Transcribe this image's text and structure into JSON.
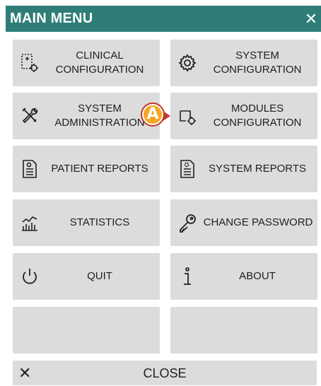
{
  "header": {
    "title": "MAIN MENU",
    "close_glyph": "✕"
  },
  "tiles": [
    {
      "line1": "CLINICAL",
      "line2": "CONFIGURATION",
      "icon": "clinical-config-icon"
    },
    {
      "line1": "SYSTEM",
      "line2": "CONFIGURATION",
      "icon": "gear-icon"
    },
    {
      "line1": "SYSTEM",
      "line2": "ADMINISTRATION",
      "icon": "tools-icon"
    },
    {
      "line1": "MODULES",
      "line2": "CONFIGURATION",
      "icon": "modules-config-icon"
    },
    {
      "line1": "PATIENT REPORTS",
      "icon": "patient-report-icon"
    },
    {
      "line1": "SYSTEM REPORTS",
      "icon": "system-report-icon"
    },
    {
      "line1": "STATISTICS",
      "icon": "statistics-icon"
    },
    {
      "line1": "CHANGE PASSWORD",
      "icon": "key-icon"
    },
    {
      "line1": "QUIT",
      "icon": "power-icon"
    },
    {
      "line1": "ABOUT",
      "icon": "info-icon"
    }
  ],
  "close_bar": {
    "label": "CLOSE",
    "glyph": "✕"
  },
  "callout": {
    "label": "A",
    "color": "#f5a623",
    "border": "#c0392b"
  },
  "colors": {
    "header": "#2e7d77",
    "tile": "#dcdcdc"
  }
}
